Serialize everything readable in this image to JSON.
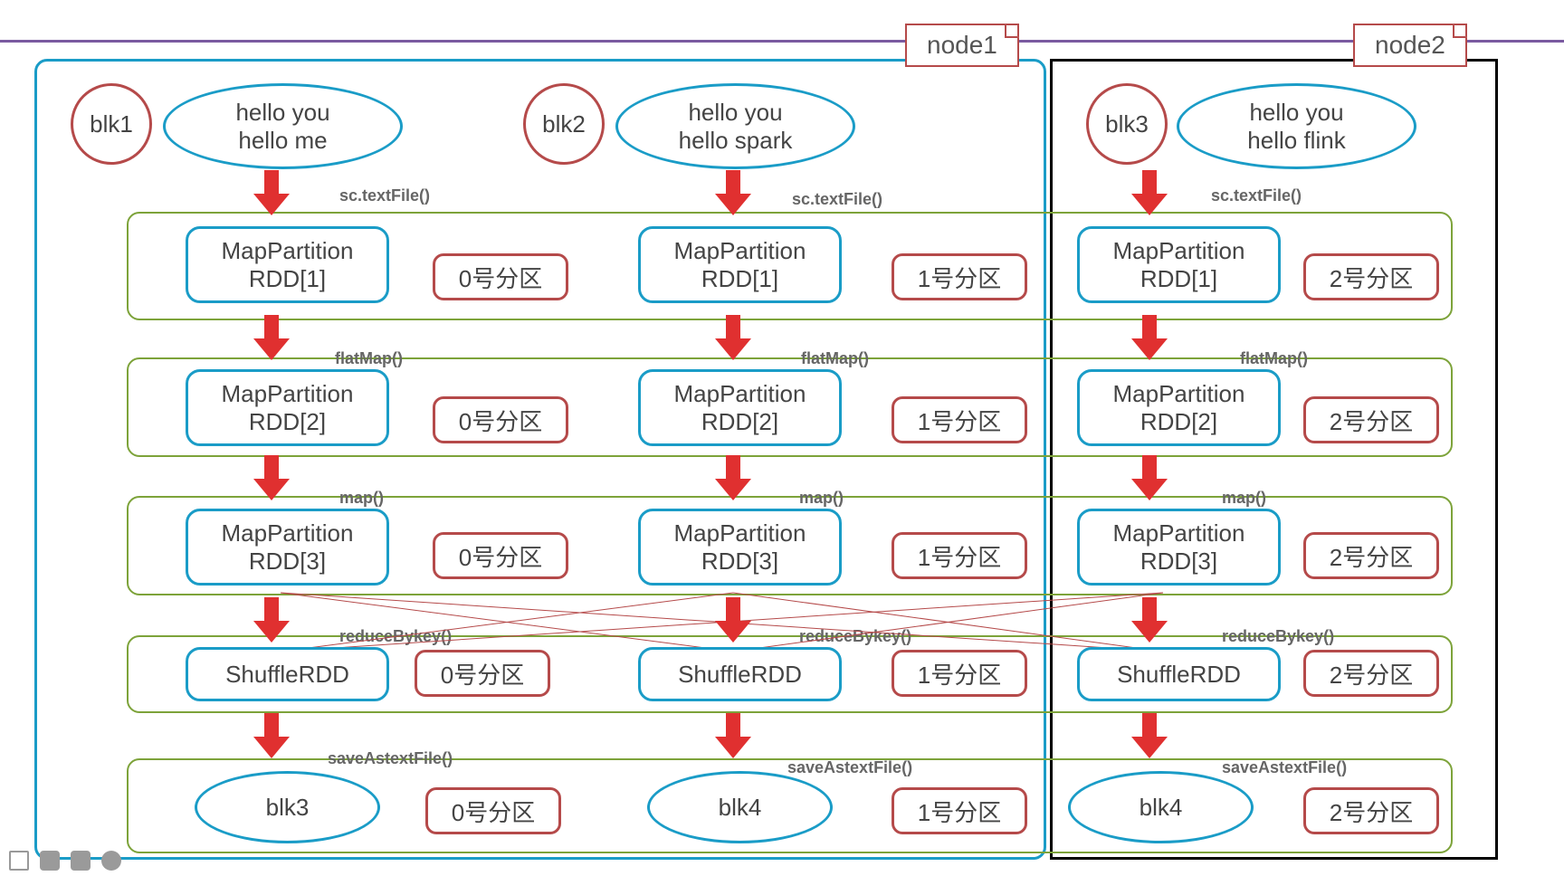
{
  "nodes": {
    "node1": "node1",
    "node2": "node2"
  },
  "blocks": {
    "blk1": "blk1",
    "blk2": "blk2",
    "blk3": "blk3"
  },
  "input_data": {
    "col0": {
      "line1": "hello you",
      "line2": "hello me"
    },
    "col1": {
      "line1": "hello you",
      "line2": "hello spark"
    },
    "col2": {
      "line1": "hello you",
      "line2": "hello flink"
    }
  },
  "ops": {
    "textfile": "sc.textFile()",
    "flatmap": "flatMap()",
    "map": "map()",
    "reducebykey": "reduceBykey()",
    "saveastext": "saveAstextFile()"
  },
  "rdd": {
    "mp1": {
      "line1": "MapPartition",
      "line2": "RDD[1]"
    },
    "mp2": {
      "line1": "MapPartition",
      "line2": "RDD[2]"
    },
    "mp3": {
      "line1": "MapPartition",
      "line2": "RDD[3]"
    },
    "shuffle": "ShuffleRDD"
  },
  "partitions": {
    "p0": "0号分区",
    "p1": "1号分区",
    "p2": "2号分区"
  },
  "output": {
    "col0": "blk3",
    "col1": "blk4",
    "col2": "blk4"
  }
}
